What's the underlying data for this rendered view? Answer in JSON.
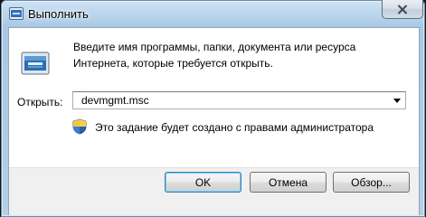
{
  "window": {
    "title": "Выполнить",
    "close_icon": "close-icon"
  },
  "dialog": {
    "description": "Введите имя программы, папки, документа или ресурса Интернета, которые требуется открыть.",
    "open_label": "Открыть:",
    "open_value": "devmgmt.msc",
    "admin_note": "Это задание будет создано с правами администратора"
  },
  "buttons": {
    "ok": "OK",
    "cancel": "Отмена",
    "browse": "Обзор..."
  },
  "icons": {
    "app": "run-icon",
    "shield": "uac-shield-icon",
    "dropdown": "chevron-down-icon"
  }
}
